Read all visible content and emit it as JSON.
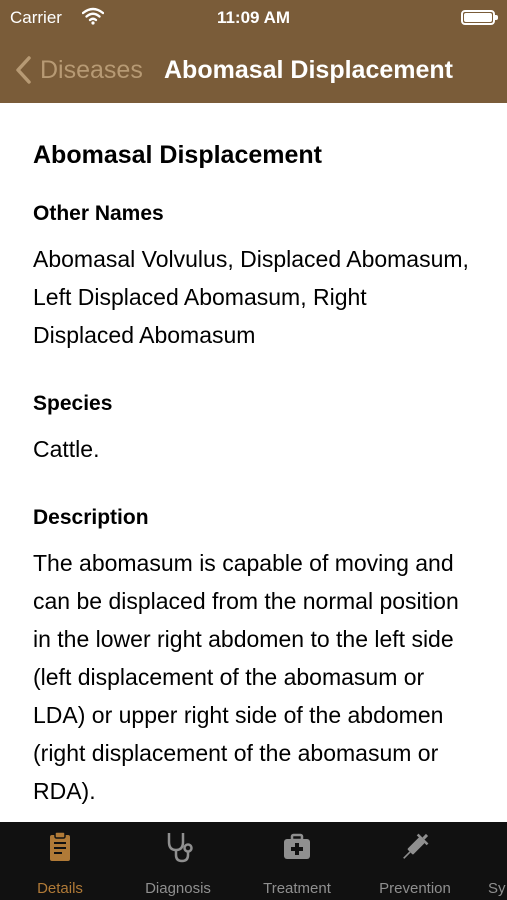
{
  "status_bar": {
    "carrier": "Carrier",
    "time": "11:09 AM"
  },
  "nav": {
    "back_label": "Diseases",
    "title": "Abomasal Displacement"
  },
  "content": {
    "title": "Abomasal Displacement",
    "sections": [
      {
        "heading": "Other Names",
        "text": "Abomasal Volvulus, Displaced Abomasum, Left Displaced Abomasum, Right Displaced Abomasum"
      },
      {
        "heading": "Species",
        "text": "Cattle."
      },
      {
        "heading": "Description",
        "text": "The abomasum is capable of moving and can be displaced from the normal position in the lower right abdomen to the left side (left displacement of the abomasum or LDA) or upper right side of the abdomen (right displacement of the abomasum or RDA)."
      }
    ]
  },
  "tabs": [
    {
      "label": "Details",
      "icon": "clipboard-icon",
      "active": true
    },
    {
      "label": "Diagnosis",
      "icon": "stethoscope-icon",
      "active": false
    },
    {
      "label": "Treatment",
      "icon": "medical-kit-icon",
      "active": false
    },
    {
      "label": "Prevention",
      "icon": "syringe-icon",
      "active": false
    },
    {
      "label": "Sy",
      "icon": "",
      "active": false
    }
  ],
  "colors": {
    "nav_bar": "#7a5c39",
    "tab_active": "#b07a37",
    "tab_inactive": "#8f8f8f",
    "tab_bar": "#111111"
  }
}
